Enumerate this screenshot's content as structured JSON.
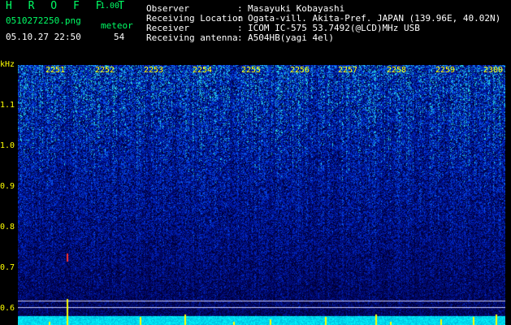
{
  "header": {
    "app_name": "H R O F F T",
    "app_version": "1.00",
    "filename": "0510272250.png",
    "datetime": "05.10.27 22:50",
    "mode_label": "meteor",
    "meteor_count": "54"
  },
  "info": {
    "observer_key": "Observer",
    "observer_value": "Masayuki Kobayashi",
    "location_key": "Receiving Location",
    "location_value": "Ogata-vill. Akita-Pref. JAPAN (139.96E, 40.02N)",
    "receiver_key": "Receiver",
    "receiver_value": "ICOM IC-575 53.7492(@LCD)MHz USB",
    "antenna_key": "Receiving antenna",
    "antenna_value": "A504HB(yagi 4el)",
    "sep": ":"
  },
  "axis": {
    "unit": "kHz",
    "y_ticks": [
      "1.1",
      "1.0",
      "0.9",
      "0.8",
      "0.7",
      "0.6"
    ],
    "x_ticks": [
      "2251",
      "2252",
      "2253",
      "2254",
      "2255",
      "2256",
      "2257",
      "2258",
      "2259",
      "2300"
    ]
  },
  "colors": {
    "text_header": "#ffffff",
    "title_green": "#00ff66",
    "axis_yellow": "#ffff00",
    "background": "#000000"
  }
}
